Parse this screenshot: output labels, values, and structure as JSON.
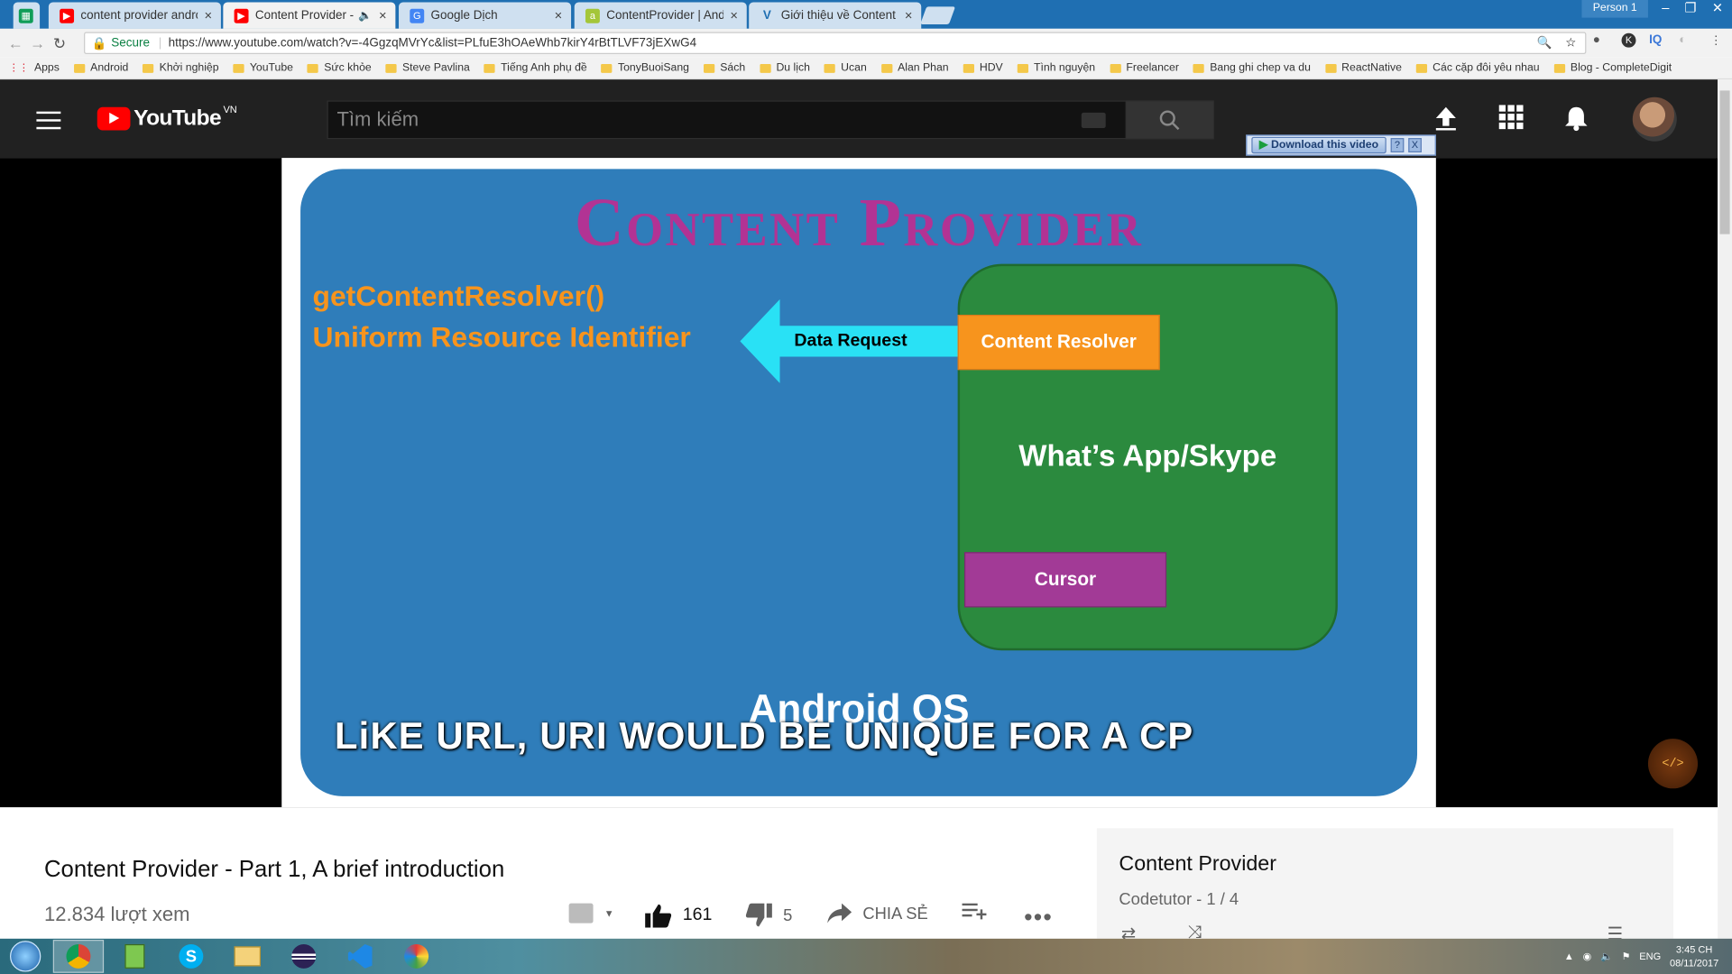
{
  "browser": {
    "tabs": [
      {
        "label": "content provider androic",
        "icon": "youtube-icon"
      },
      {
        "label": "Content Provider - Pa",
        "icon": "youtube-icon",
        "active": true
      },
      {
        "label": "Google Dịch",
        "icon": "google-translate-icon"
      },
      {
        "label": "ContentProvider | Andro",
        "icon": "android-icon"
      },
      {
        "label": "Giới thiệu về Content Pro",
        "icon": "v-icon"
      }
    ],
    "profile": "Person 1",
    "secure_label": "Secure",
    "url": "https://www.youtube.com/watch?v=-4GgzqMVrYc&list=PLfuE3hOAeWhb7kirY4rBtTLVF73jEXwG4",
    "bookmarks": [
      "Apps",
      "Android",
      "Khởi nghiệp",
      "YouTube",
      "Sức khỏe",
      "Steve Pavlina",
      "Tiếng Anh phụ đề",
      "TonyBuoiSang",
      "Sách",
      "Du lịch",
      "Ucan",
      "Alan Phan",
      "HDV",
      "Tình nguyện",
      "Freelancer",
      "Bang ghi chep va du",
      "ReactNative",
      "Các cặp đôi yêu nhau",
      "Blog - CompleteDigit"
    ]
  },
  "youtube": {
    "logo_text": "YouTube",
    "region": "VN",
    "search_placeholder": "Tìm kiếm",
    "download_label": "Download this video",
    "download_help": "?",
    "download_close": "X"
  },
  "slide": {
    "title": "Content Provider",
    "line1": "getContentResolver()",
    "line2": "Uniform Resource Identifier",
    "arrow_label": "Data Request",
    "resolver": "Content Resolver",
    "app": "What’s App/Skype",
    "cursor": "Cursor",
    "os": "Android OS",
    "caption": "LiKE URL, URI WOULD BE UNIQUE FOR A CP"
  },
  "video": {
    "title": "Content Provider - Part 1, A brief introduction",
    "views": "12.834 lượt xem",
    "likes": "161",
    "dislikes": "5",
    "share": "CHIA SẺ"
  },
  "playlist": {
    "title": "Content Provider",
    "sub": "Codetutor - 1 / 4"
  },
  "taskbar": {
    "lang": "ENG",
    "time": "3:45 CH",
    "date": "08/11/2017"
  },
  "colors": {
    "slide_bg": "#2f7dba",
    "title": "#b23394",
    "orange": "#f7941d",
    "green": "#2b8a3e",
    "cyan": "#29e1f5",
    "purple": "#a23a96"
  }
}
